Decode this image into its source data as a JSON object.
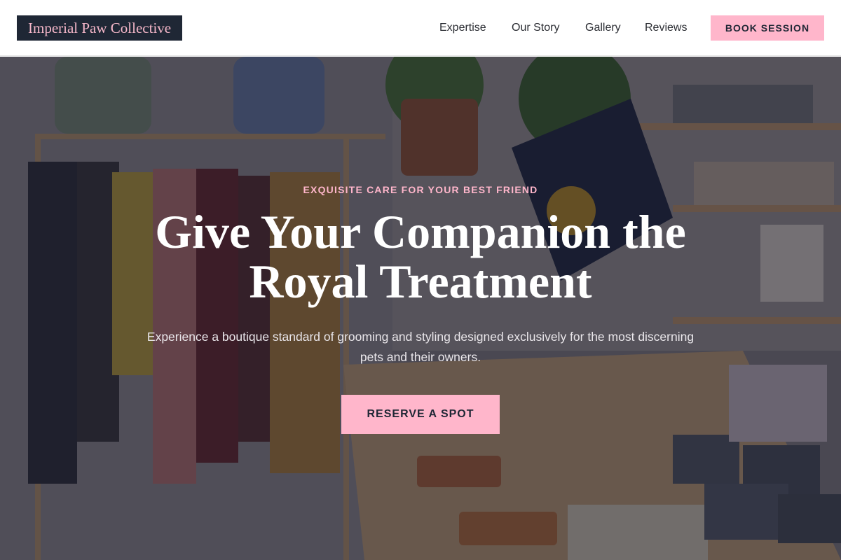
{
  "brand": {
    "name": "Imperial Paw Collective"
  },
  "nav": {
    "items": [
      {
        "label": "Expertise"
      },
      {
        "label": "Our Story"
      },
      {
        "label": "Gallery"
      },
      {
        "label": "Reviews"
      }
    ],
    "cta_label": "BOOK SESSION"
  },
  "hero": {
    "eyebrow": "EXQUISITE CARE FOR YOUR BEST FRIEND",
    "headline": "Give Your Companion the Royal Treatment",
    "subtext": "Experience a boutique standard of grooming and styling designed exclusively for the most discerning pets and their owners.",
    "cta_label": "RESERVE A SPOT"
  },
  "colors": {
    "accent": "#ffb6cb",
    "dark": "#1f2735"
  }
}
